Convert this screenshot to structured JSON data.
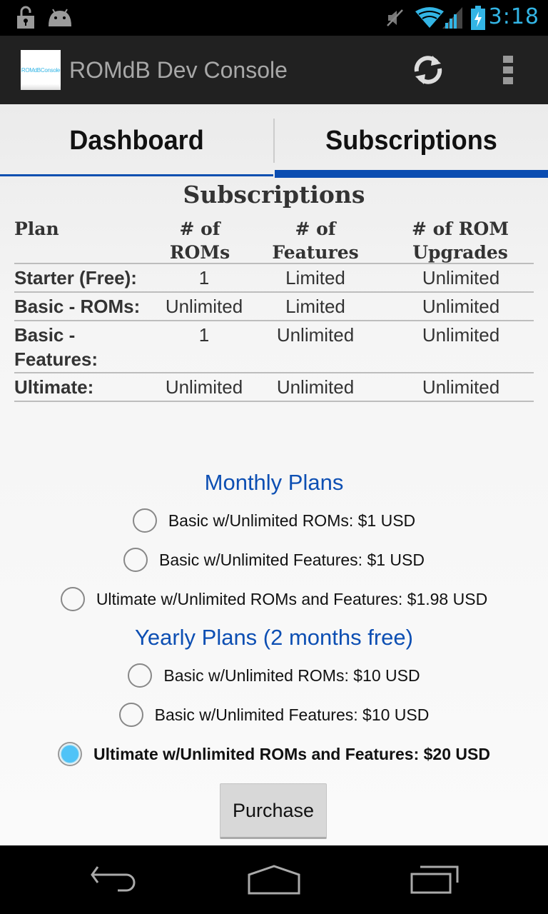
{
  "status_bar": {
    "time": "3:18",
    "icons": [
      "unlock-icon",
      "android-icon",
      "mute-icon",
      "wifi-icon",
      "signal-icon",
      "battery-charging-icon"
    ]
  },
  "action_bar": {
    "app_icon_text": "ROMdBConsole",
    "title": "ROMdB Dev Console",
    "actions": [
      "refresh-icon",
      "overflow-menu-icon"
    ]
  },
  "tabs": [
    {
      "label": "Dashboard",
      "selected": false
    },
    {
      "label": "Subscriptions",
      "selected": true
    }
  ],
  "section_title": "Subscriptions",
  "table": {
    "headers": [
      {
        "line1": "Plan",
        "line2": ""
      },
      {
        "line1": "# of",
        "line2": "ROMs"
      },
      {
        "line1": "# of",
        "line2": "Features"
      },
      {
        "line1": "# of ROM",
        "line2": "Upgrades"
      }
    ],
    "rows": [
      {
        "plan": "Starter (Free):",
        "roms": "1",
        "features": "Limited",
        "upgrades": "Unlimited"
      },
      {
        "plan": "Basic - ROMs:",
        "roms": "Unlimited",
        "features": "Limited",
        "upgrades": "Unlimited"
      },
      {
        "plan": "Basic -\nFeatures:",
        "plan_line1": "Basic -",
        "plan_line2": "Features:",
        "roms": "1",
        "features": "Unlimited",
        "upgrades": "Unlimited"
      },
      {
        "plan": "Ultimate:",
        "roms": "Unlimited",
        "features": "Unlimited",
        "upgrades": "Unlimited"
      }
    ]
  },
  "monthly": {
    "heading": "Monthly Plans",
    "options": [
      {
        "label": "Basic w/Unlimited ROMs: $1 USD",
        "checked": false
      },
      {
        "label": "Basic w/Unlimited Features: $1 USD",
        "checked": false
      },
      {
        "label": "Ultimate w/Unlimited ROMs and Features: $1.98 USD",
        "checked": false
      }
    ]
  },
  "yearly": {
    "heading": "Yearly Plans (2 months free)",
    "options": [
      {
        "label": "Basic w/Unlimited ROMs: $10 USD",
        "checked": false
      },
      {
        "label": "Basic w/Unlimited Features: $10 USD",
        "checked": false
      },
      {
        "label": "Ultimate w/Unlimited ROMs and Features: $20 USD",
        "checked": true
      }
    ]
  },
  "purchase_label": "Purchase",
  "nav_bar": [
    "back-icon",
    "home-icon",
    "recent-apps-icon"
  ],
  "colors": {
    "accent_blue": "#0a4cb1",
    "status_blue": "#33b5e5",
    "radio_checked": "#4fc3f7"
  }
}
